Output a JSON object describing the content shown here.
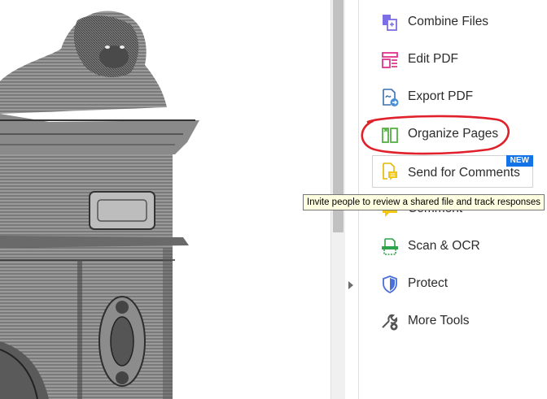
{
  "tools": [
    {
      "label": "Combine Files",
      "icon": "combine-files-icon",
      "color": "#7c6ee6"
    },
    {
      "label": "Edit PDF",
      "icon": "edit-pdf-icon",
      "color": "#e0338f"
    },
    {
      "label": "Export PDF",
      "icon": "export-pdf-icon",
      "color": "#4a8fd4"
    },
    {
      "label": "Organize Pages",
      "icon": "organize-pages-icon",
      "color": "#56b043"
    },
    {
      "label": "Send for Comments",
      "icon": "send-for-comments-icon",
      "color": "#f2c70f",
      "badge": "NEW"
    },
    {
      "label": "Comment",
      "icon": "comment-icon",
      "color": "#f2c70f"
    },
    {
      "label": "Scan & OCR",
      "icon": "scan-ocr-icon",
      "color": "#2fa34a"
    },
    {
      "label": "Protect",
      "icon": "protect-icon",
      "color": "#4a6fd8"
    },
    {
      "label": "More Tools",
      "icon": "more-tools-icon",
      "color": "#555555"
    }
  ],
  "tooltip": "Invite people to review a shared file and track responses",
  "annotation_color": "#e0202a"
}
